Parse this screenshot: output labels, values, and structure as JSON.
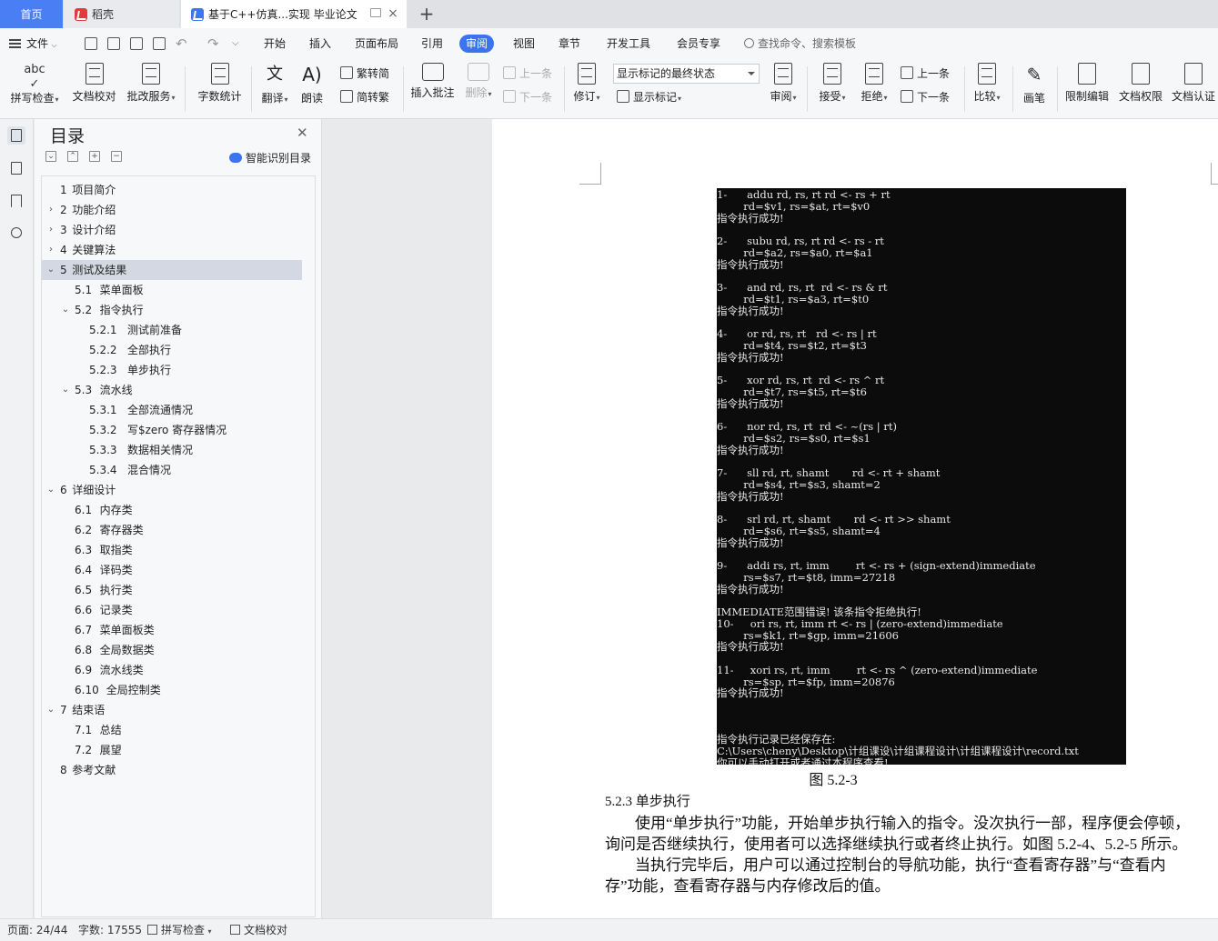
{
  "tabs": {
    "home": "首页",
    "daoke": "稻壳",
    "document": "基于C++仿真...实现 毕业论文"
  },
  "menu": {
    "file": "文件",
    "items": [
      "开始",
      "插入",
      "页面布局",
      "引用",
      "审阅",
      "视图",
      "章节",
      "开发工具",
      "会员专享"
    ],
    "active": "审阅",
    "search_placeholder": "查找命令、搜索模板"
  },
  "ribbon": {
    "spell_check": "拼写检查",
    "doc_proof": "文档校对",
    "correction_service": "批改服务",
    "word_count": "字数统计",
    "translate": "翻译",
    "read_aloud": "朗读",
    "trad_convert": "繁转简",
    "simp_convert": "简转繁",
    "insert_comment": "插入批注",
    "delete": "删除",
    "prev_comment": "上一条",
    "next_comment": "下一条",
    "revise": "修订",
    "markup_state": "显示标记的最终状态",
    "show_markup": "显示标记",
    "review": "审阅",
    "accept": "接受",
    "reject": "拒绝",
    "prev_change": "上一条",
    "next_change": "下一条",
    "compare": "比较",
    "pen": "画笔",
    "restrict_edit": "限制编辑",
    "doc_permission": "文档权限",
    "doc_auth": "文档认证"
  },
  "toc": {
    "title": "目录",
    "smart_label": "智能识别目录",
    "items": [
      {
        "num": "1",
        "text": "项目简介"
      },
      {
        "num": "2",
        "text": "功能介绍"
      },
      {
        "num": "3",
        "text": "设计介绍"
      },
      {
        "num": "4",
        "text": "关键算法"
      },
      {
        "num": "5",
        "text": "测试及结果"
      },
      {
        "num": "5.1",
        "text": "菜单面板"
      },
      {
        "num": "5.2",
        "text": "指令执行"
      },
      {
        "num": "5.2.1",
        "text": "测试前准备"
      },
      {
        "num": "5.2.2",
        "text": "全部执行"
      },
      {
        "num": "5.2.3",
        "text": "单步执行"
      },
      {
        "num": "5.3",
        "text": "流水线"
      },
      {
        "num": "5.3.1",
        "text": "全部流通情况"
      },
      {
        "num": "5.3.2",
        "text": "写$zero 寄存器情况"
      },
      {
        "num": "5.3.3",
        "text": "数据相关情况"
      },
      {
        "num": "5.3.4",
        "text": "混合情况"
      },
      {
        "num": "6",
        "text": "详细设计"
      },
      {
        "num": "6.1",
        "text": "内存类"
      },
      {
        "num": "6.2",
        "text": "寄存器类"
      },
      {
        "num": "6.3",
        "text": "取指类"
      },
      {
        "num": "6.4",
        "text": "译码类"
      },
      {
        "num": "6.5",
        "text": "执行类"
      },
      {
        "num": "6.6",
        "text": "记录类"
      },
      {
        "num": "6.7",
        "text": "菜单面板类"
      },
      {
        "num": "6.8",
        "text": "全局数据类"
      },
      {
        "num": "6.9",
        "text": "流水线类"
      },
      {
        "num": "6.10",
        "text": "全局控制类"
      },
      {
        "num": "7",
        "text": "结束语"
      },
      {
        "num": "7.1",
        "text": "总结"
      },
      {
        "num": "7.2",
        "text": "展望"
      },
      {
        "num": "8",
        "text": "参考文献"
      }
    ]
  },
  "console_lines": [
    "1-      addu rd, rs, rt rd <- rs + rt",
    "        rd=$v1, rs=$at, rt=$v0",
    "指令执行成功!",
    "",
    "2-      subu rd, rs, rt rd <- rs - rt",
    "        rd=$a2, rs=$a0, rt=$a1",
    "指令执行成功!",
    "",
    "3-      and rd, rs, rt  rd <- rs & rt",
    "        rd=$t1, rs=$a3, rt=$t0",
    "指令执行成功!",
    "",
    "4-      or rd, rs, rt   rd <- rs | rt",
    "        rd=$t4, rs=$t2, rt=$t3",
    "指令执行成功!",
    "",
    "5-      xor rd, rs, rt  rd <- rs ^ rt",
    "        rd=$t7, rs=$t5, rt=$t6",
    "指令执行成功!",
    "",
    "6-      nor rd, rs, rt  rd <- ~(rs | rt)",
    "        rd=$s2, rs=$s0, rt=$s1",
    "指令执行成功!",
    "",
    "7-      sll rd, rt, shamt       rd <- rt + shamt",
    "        rd=$s4, rt=$s3, shamt=2",
    "指令执行成功!",
    "",
    "8-      srl rd, rt, shamt       rd <- rt >> shamt",
    "        rd=$s6, rt=$s5, shamt=4",
    "指令执行成功!",
    "",
    "9-      addi rs, rt, imm        rt <- rs + (sign-extend)immediate",
    "        rs=$s7, rt=$t8, imm=27218",
    "指令执行成功!",
    "",
    "IMMEDIATE范围错误! 该条指令拒绝执行!",
    "10-     ori rs, rt, imm rt <- rs | (zero-extend)immediate",
    "        rs=$k1, rt=$gp, imm=21606",
    "指令执行成功!",
    "",
    "11-     xori rs, rt, imm        rt <- rs ^ (zero-extend)immediate",
    "        rs=$sp, rt=$fp, imm=20876",
    "指令执行成功!",
    "",
    "",
    "",
    "指令执行记录已经保存在:",
    "C:\\Users\\cheny\\Desktop\\计组课设\\计组课程设计\\计组课程设计\\record.txt",
    "你可以手动打开或者通过本程序查看!"
  ],
  "document": {
    "figure_caption": "图 5.2-3",
    "section_heading": "5.2.3  单步执行",
    "para1_line1": "使用“单步执行”功能，开始单步执行输入的指令。没次执行一部，程序便会停顿，",
    "para1_line2": "询问是否继续执行，使用者可以选择继续执行或者终止执行。如图 5.2-4、5.2-5 所示。",
    "para2_line1": "当执行完毕后，用户可以通过控制台的导航功能，执行“查看寄存器”与“查看内",
    "para2_line2": "存”功能，查看寄存器与内存修改后的值。"
  },
  "status": {
    "page": "页面: 24/44",
    "word_count": "字数: 17555",
    "spell_check": "拼写检查",
    "doc_proof": "文档校对"
  },
  "colors": {
    "accent": "#3a74f1",
    "console_bg": "#0c0c0c"
  }
}
